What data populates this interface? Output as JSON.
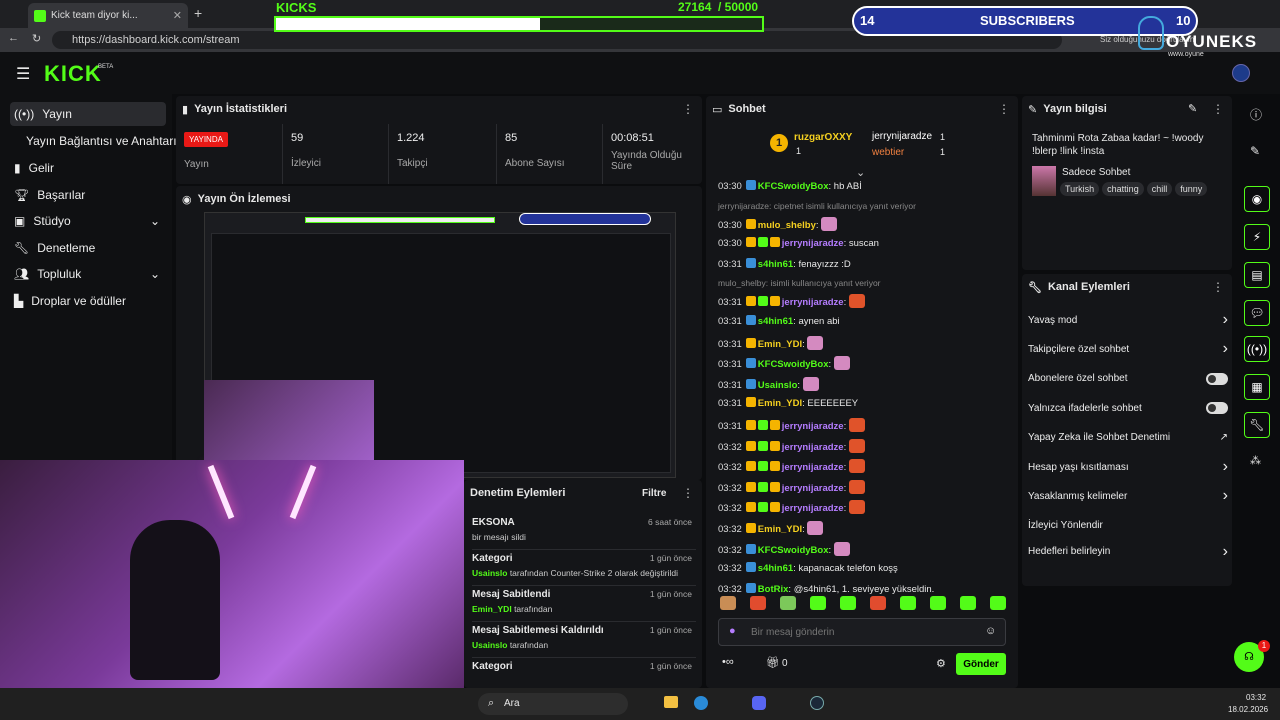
{
  "browser": {
    "tab_title": "Kick team diyor ki...",
    "url": "https://dashboard.kick.com/stream",
    "notification_text": "Siz olduğunuzu doğrulayın"
  },
  "overlay": {
    "kicks_label": "KICKS",
    "kicks_current": "27164",
    "kicks_goal": "/ 50000",
    "kicks_progress": 0.543,
    "sub_left": "14",
    "sub_label": "SUBSCRIBERS",
    "sub_right": "10",
    "brand": "OYUNEKS",
    "brand_url": "www.oyune"
  },
  "app": {
    "logo": "KICK",
    "logo_tag": "BETA"
  },
  "sidebar": {
    "items": [
      "Yayın",
      "Yayın Bağlantısı ve Anahtarı",
      "Gelir",
      "Başarılar",
      "Stüdyo",
      "Denetleme",
      "Topluluk",
      "Droplar ve ödüller"
    ]
  },
  "stats": {
    "title": "Yayın İstatistikleri",
    "live_badge": "YAYINDA",
    "live_label": "Yayın",
    "items": [
      {
        "value": "59",
        "label": "İzleyici"
      },
      {
        "value": "1.224",
        "label": "Takipçi"
      },
      {
        "value": "85",
        "label": "Abone Sayısı"
      },
      {
        "value": "00:08:51",
        "label": "Yayında Olduğu Süre"
      }
    ]
  },
  "preview": {
    "title": "Yayın Ön İzlemesi"
  },
  "chat": {
    "title": "Sohbet",
    "top": [
      {
        "name": "ruzgarOXXY",
        "count": "1"
      },
      {
        "name": "jerrynijaradze",
        "count": "1"
      },
      {
        "name": "webtier",
        "count": "1"
      }
    ],
    "lines": [
      {
        "t": "03:30",
        "u": "KFCSwoidyBox",
        "c": "g",
        "m": "hb ABİ"
      },
      {
        "reply": "jerrynijaradze: cipetnet isimli kullanıcıya yanıt veriyor"
      },
      {
        "t": "03:30",
        "u": "mulo_shelby",
        "c": "y",
        "m": ""
      },
      {
        "t": "03:30",
        "u": "jerrynijaradze",
        "c": "p",
        "m": "suscan"
      },
      {
        "t": "03:31",
        "u": "s4hin61",
        "c": "g",
        "m": "fenayızzz :D"
      },
      {
        "reply": "mulo_shelby: isimli kullanıcıya yanıt veriyor"
      },
      {
        "t": "03:31",
        "u": "jerrynijaradze",
        "c": "p",
        "m": ""
      },
      {
        "t": "03:31",
        "u": "s4hin61",
        "c": "g",
        "m": "aynen abi"
      },
      {
        "t": "03:31",
        "u": "Emin_YDI",
        "c": "y",
        "m": ""
      },
      {
        "t": "03:31",
        "u": "KFCSwoidyBox",
        "c": "g",
        "m": ""
      },
      {
        "t": "03:31",
        "u": "Usainslo",
        "c": "g",
        "m": ""
      },
      {
        "t": "03:31",
        "u": "Emin_YDI",
        "c": "y",
        "m": "EEEEEEEY"
      },
      {
        "t": "03:31",
        "u": "jerrynijaradze",
        "c": "p",
        "m": ""
      },
      {
        "t": "03:32",
        "u": "jerrynijaradze",
        "c": "p",
        "m": ""
      },
      {
        "t": "03:32",
        "u": "jerrynijaradze",
        "c": "p",
        "m": ""
      },
      {
        "t": "03:32",
        "u": "jerrynijaradze",
        "c": "p",
        "m": ""
      },
      {
        "t": "03:32",
        "u": "jerrynijaradze",
        "c": "p",
        "m": ""
      },
      {
        "t": "03:32",
        "u": "Emin_YDI",
        "c": "y",
        "m": ""
      },
      {
        "t": "03:32",
        "u": "KFCSwoidyBox",
        "c": "g",
        "m": ""
      },
      {
        "t": "03:32",
        "u": "s4hin61",
        "c": "g",
        "m": "kapanacak telefon koşş"
      },
      {
        "t": "03:32",
        "u": "BotRix",
        "c": "g",
        "m": "@s4hin61, 1. seviyeye yükseldin."
      }
    ],
    "input_placeholder": "Bir mesaj gönderin",
    "points": "0",
    "send_label": "Gönder"
  },
  "info": {
    "title": "Yayın bilgisi",
    "stream_title": "Tahminmi Rota Zabaa kadar! ~ !woody !blerp !link !insta",
    "category": "Sadece Sohbet",
    "tags": [
      "Turkish",
      "chatting",
      "chill",
      "funny"
    ]
  },
  "channel_actions": {
    "title": "Kanal Eylemleri",
    "items": [
      {
        "label": "Yavaş mod",
        "type": "arrow"
      },
      {
        "label": "Takipçilere özel sohbet",
        "type": "arrow"
      },
      {
        "label": "Abonelere özel sohbet",
        "type": "toggle"
      },
      {
        "label": "Yalnızca ifadelerle sohbet",
        "type": "toggle"
      },
      {
        "label": "Yapay Zeka ile Sohbet Denetimi",
        "type": "ext"
      },
      {
        "label": "Hesap yaşı kısıtlaması",
        "type": "arrow"
      },
      {
        "label": "Yasaklanmış kelimeler",
        "type": "arrow"
      },
      {
        "label": "İzleyici Yönlendir",
        "type": "none"
      },
      {
        "label": "Hedefleri belirleyin",
        "type": "arrow"
      }
    ]
  },
  "moderation": {
    "title": "Denetim Eylemleri",
    "filter": "Filtre",
    "items": [
      {
        "title": "EKSONA",
        "when": "6 saat önce",
        "desc": "bir mesajı sildi",
        "user": ""
      },
      {
        "title": "Kategori",
        "when": "1 gün önce",
        "desc": "tarafından Counter-Strike 2 olarak değiştirildi",
        "user": "Usainslo"
      },
      {
        "title": "Mesaj Sabitlendi",
        "when": "1 gün önce",
        "desc": "tarafından",
        "user": "Emin_YDI"
      },
      {
        "title": "Mesaj Sabitlemesi Kaldırıldı",
        "when": "1 gün önce",
        "desc": "tarafından",
        "user": "Usainslo"
      },
      {
        "title": "Kategori",
        "when": "1 gün önce",
        "desc": "",
        "user": ""
      }
    ]
  },
  "taskbar": {
    "search": "Ara",
    "time": "03:32",
    "date": "18.02.2026"
  },
  "colors": {
    "accent": "#53fc18",
    "bg": "#0b0c0e",
    "panel": "#141518",
    "live": "#e91916",
    "sub_bar": "#233399"
  }
}
